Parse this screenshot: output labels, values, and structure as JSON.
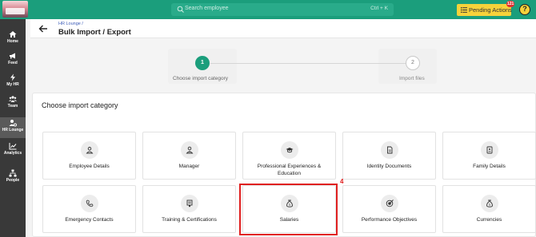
{
  "topbar": {
    "search_placeholder": "Search employee",
    "search_shortcut": "Ctrl + K",
    "pending_label": "Pending Actions",
    "pending_count": "121",
    "help_symbol": "?",
    "accent_color": "#1b9e7c",
    "pending_color": "#f6d23b"
  },
  "sidebar": {
    "items": [
      {
        "label": "Home",
        "icon": "home-icon"
      },
      {
        "label": "Feed",
        "icon": "megaphone-icon"
      },
      {
        "label": "My HR",
        "icon": "bolt-icon"
      },
      {
        "label": "Team",
        "icon": "team-icon"
      },
      {
        "label": "HR Lounge",
        "icon": "user-gear-icon",
        "active": true
      },
      {
        "label": "Analytics",
        "icon": "chart-icon"
      },
      {
        "label": "People",
        "icon": "org-chart-icon"
      }
    ]
  },
  "header": {
    "breadcrumb": "HR Lounge /",
    "title": "Bulk Import / Export"
  },
  "steps": [
    {
      "number": "1",
      "label": "Choose import category",
      "state": "active"
    },
    {
      "number": "2",
      "label": "Import files",
      "state": "pending"
    }
  ],
  "panel": {
    "title": "Choose import category",
    "categories": [
      {
        "label": "Employee Details",
        "icon": "user-icon"
      },
      {
        "label": "Manager",
        "icon": "user-tie-icon"
      },
      {
        "label": "Professional Experiences & Education",
        "icon": "graduation-cap-icon"
      },
      {
        "label": "Identity Documents",
        "icon": "document-icon"
      },
      {
        "label": "Family Details",
        "icon": "id-card-icon"
      },
      {
        "label": "Emergency Contacts",
        "icon": "phone-icon"
      },
      {
        "label": "Training & Certifications",
        "icon": "certificate-icon"
      },
      {
        "label": "Salaries",
        "icon": "money-bag-icon"
      },
      {
        "label": "Performance Objectives",
        "icon": "target-icon"
      },
      {
        "label": "Currencies",
        "icon": "money-bag-icon"
      }
    ]
  },
  "annotation": {
    "label": "4",
    "color": "#e02020"
  }
}
